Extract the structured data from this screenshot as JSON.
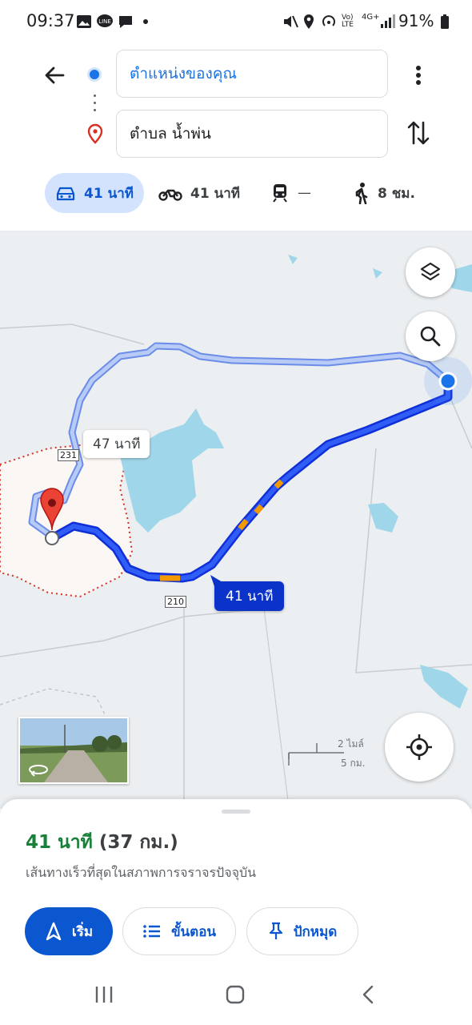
{
  "status": {
    "time": "09:37",
    "network_label": "Vo) LTE",
    "signal_label": "4G+",
    "battery": "91%"
  },
  "directions": {
    "origin_value": "ตำแหน่งของคุณ",
    "destination_value": "ตำบล น้ำพ่น"
  },
  "modes": [
    {
      "icon": "car-icon",
      "label": "41 นาที",
      "selected": true
    },
    {
      "icon": "motorcycle-icon",
      "label": "41 นาที"
    },
    {
      "icon": "train-icon",
      "label": "—"
    },
    {
      "icon": "walk-icon",
      "label": "8 ชม."
    }
  ],
  "map": {
    "alt_route_time": "47 นาที",
    "main_route_time": "41 นาที",
    "route_shield_1": "231",
    "route_shield_2": "210",
    "scale_imperial": "2 ไมล์",
    "scale_metric": "5 กม."
  },
  "summary": {
    "time": "41 นาที",
    "distance": "(37 กม.)",
    "description": "เส้นทางเร็วที่สุดในสภาพการจราจรปัจจุบัน"
  },
  "actions": {
    "start_label": "เริ่ม",
    "steps_label": "ขั้นตอน",
    "pin_label": "ปักหมุด"
  },
  "colors": {
    "accent": "#0b57d0",
    "route_main": "#1a3bf0",
    "route_alt": "#a8c0f5",
    "eta_green": "#188038"
  }
}
